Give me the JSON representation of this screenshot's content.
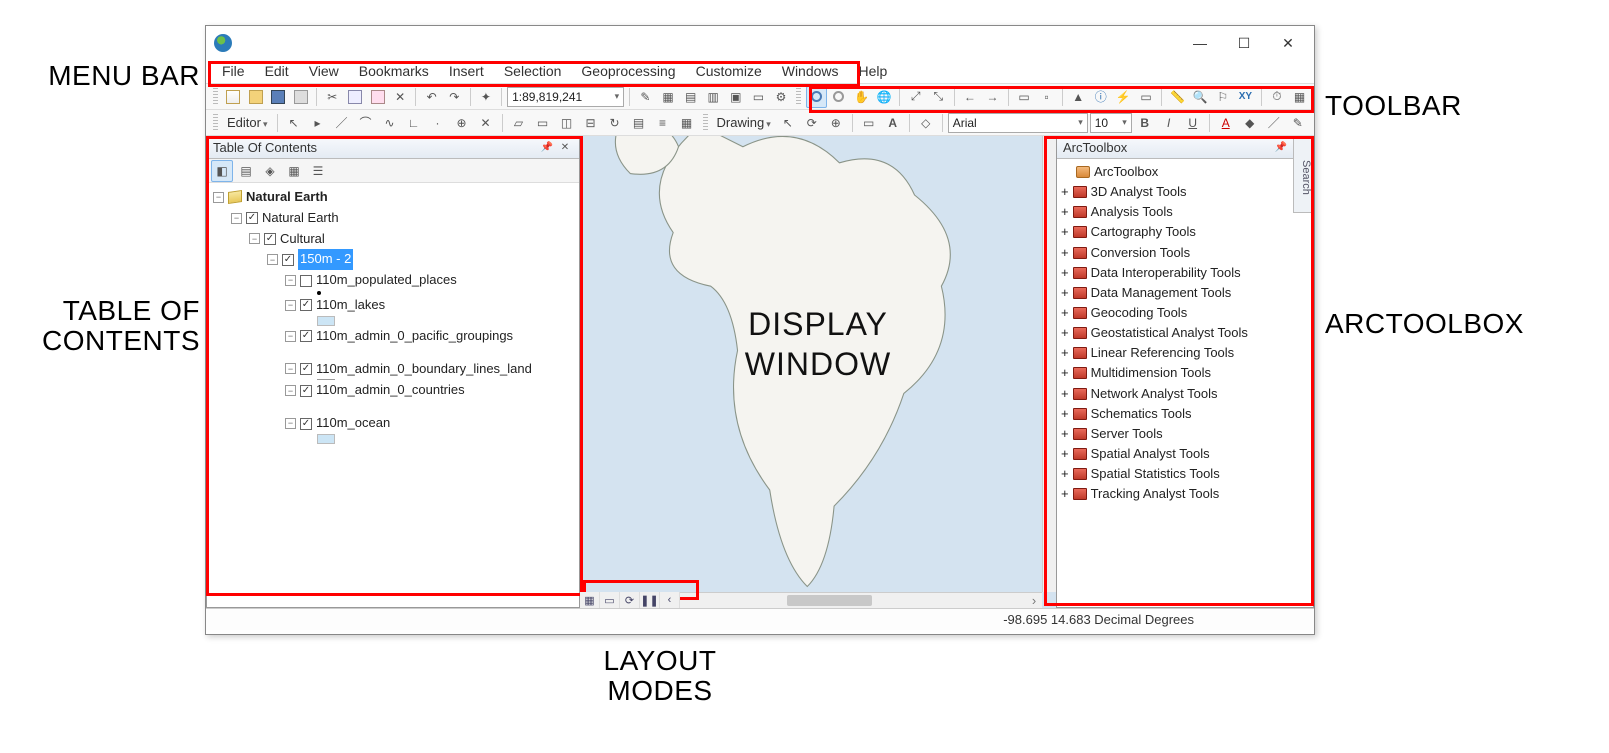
{
  "annotations": {
    "menu_bar": "MENU BAR",
    "toc_line1": "TABLE OF",
    "toc_line2": "CONTENTS",
    "toolbar": "TOOLBAR",
    "arctoolbox": "ARCTOOLBOX",
    "layout_line1": "LAYOUT",
    "layout_line2": "MODES",
    "display_line1": "DISPLAY",
    "display_line2": "WINDOW"
  },
  "window_controls": {
    "min": "—",
    "max": "☐",
    "close": "✕"
  },
  "menubar": [
    "File",
    "Edit",
    "View",
    "Bookmarks",
    "Insert",
    "Selection",
    "Geoprocessing",
    "Customize",
    "Windows",
    "Help"
  ],
  "toolbar1": {
    "scale": "1:89,819,241"
  },
  "toolbar2": {
    "editor": "Editor",
    "drawing": "Drawing",
    "font": "Arial",
    "font_size": "10"
  },
  "toc": {
    "title": "Table Of Contents",
    "root": "Natural Earth",
    "group1": "Natural Earth",
    "group2": "Cultural",
    "selected": "150m - 2",
    "layers": [
      "110m_populated_places",
      "110m_lakes",
      "110m_admin_0_pacific_groupings",
      "110m_admin_0_boundary_lines_land",
      "110m_admin_0_countries",
      "110m_ocean"
    ]
  },
  "toolbox": {
    "title": "ArcToolbox",
    "root": "ArcToolbox",
    "items": [
      "3D Analyst Tools",
      "Analysis Tools",
      "Cartography Tools",
      "Conversion Tools",
      "Data Interoperability Tools",
      "Data Management Tools",
      "Geocoding Tools",
      "Geostatistical Analyst Tools",
      "Linear Referencing Tools",
      "Multidimension Tools",
      "Network Analyst Tools",
      "Schematics Tools",
      "Server Tools",
      "Spatial Analyst Tools",
      "Spatial Statistics Tools",
      "Tracking Analyst Tools"
    ]
  },
  "search_tab": "Search",
  "status": {
    "coords": "-98.695  14.683 Decimal Degrees"
  }
}
